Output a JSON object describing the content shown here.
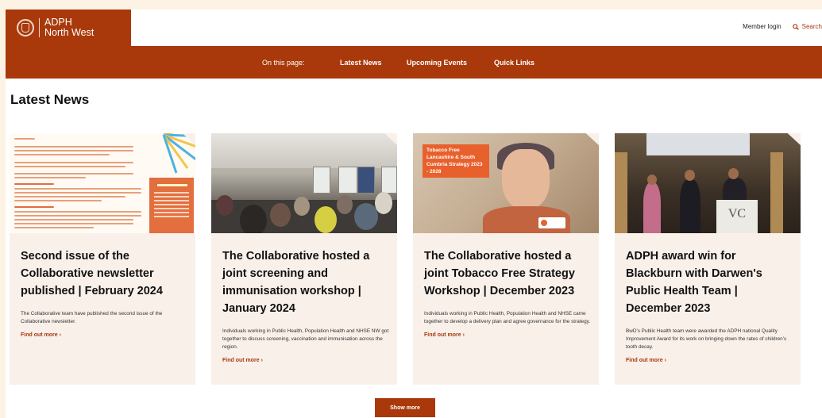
{
  "header": {
    "logo_line1": "ADPH",
    "logo_line2": "North West",
    "member_login": "Member login",
    "search_label": "Search"
  },
  "nav": {
    "on_this_page": "On this page:",
    "links": [
      "Latest News",
      "Upcoming Events",
      "Quick Links"
    ]
  },
  "section_title": "Latest News",
  "cards": [
    {
      "title": "Second issue of the Collaborative newsletter published | February 2024",
      "description": "The Collaborative team have published the second issue of the Collaborative newsletter.",
      "link": "Find out more ›"
    },
    {
      "title": "The Collaborative hosted a joint screening and immunisation workshop | January 2024",
      "description": "Individuals working in Public Health, Population Health and NHSE NW got together to discuss screening, vaccination and immunisation across the region.",
      "link": "Find out more ›"
    },
    {
      "title": "The Collaborative hosted a joint Tobacco Free Strategy Workshop | December 2023",
      "description": "Individuals working in Public Health, Population Health and NHSE came together to develop a delivery plan and agree governance for the strategy.",
      "link": "Find out more ›",
      "image_tag": "Tobacco Free Lancashire & South Cumbria Strategy 2023 - 2028"
    },
    {
      "title": "ADPH award win for Blackburn with Darwen's Public Health Team | December 2023",
      "description": "BwD's Public Health team were awarded the ADPH national Quality Improvement Award for its work on bringing down the rates of children's tooth decay.",
      "link": "Find out more ›",
      "image_lectern": "VC"
    }
  ],
  "show_more": "Show more",
  "colors": {
    "brand": "#a9390b",
    "card_bg": "#f9f0ea",
    "frame_bg": "#fdf3e4"
  }
}
